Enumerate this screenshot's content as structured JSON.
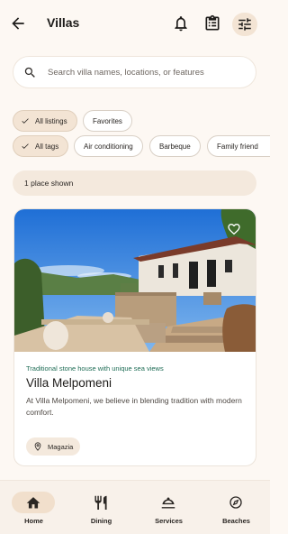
{
  "header": {
    "title": "Villas"
  },
  "search": {
    "placeholder": "Search villa names, locations, or features"
  },
  "filters": {
    "row1": [
      {
        "label": "All listings",
        "selected": true
      },
      {
        "label": "Favorites",
        "selected": false
      }
    ],
    "row2": [
      {
        "label": "All tags",
        "selected": true
      },
      {
        "label": "Air conditioning",
        "selected": false
      },
      {
        "label": "Barbeque",
        "selected": false
      },
      {
        "label": "Family friend",
        "selected": false
      }
    ]
  },
  "results": {
    "count_label": "1 place shown"
  },
  "listing": {
    "tagline": "Traditional stone house with unique sea views",
    "name": "Villa Melpomeni",
    "description": "At Villa Melpomeni, we believe in blending tradition with modern comfort.",
    "location": "Magazia",
    "favorited": false
  },
  "nav": [
    {
      "label": "Home",
      "icon": "home-icon",
      "active": true
    },
    {
      "label": "Dining",
      "icon": "dining-icon",
      "active": false
    },
    {
      "label": "Services",
      "icon": "room-service-icon",
      "active": false
    },
    {
      "label": "Beaches",
      "icon": "compass-icon",
      "active": false
    }
  ],
  "colors": {
    "accent_bg": "#f3e4d4",
    "tagline": "#1f6d56",
    "background": "#fdf8f3"
  }
}
